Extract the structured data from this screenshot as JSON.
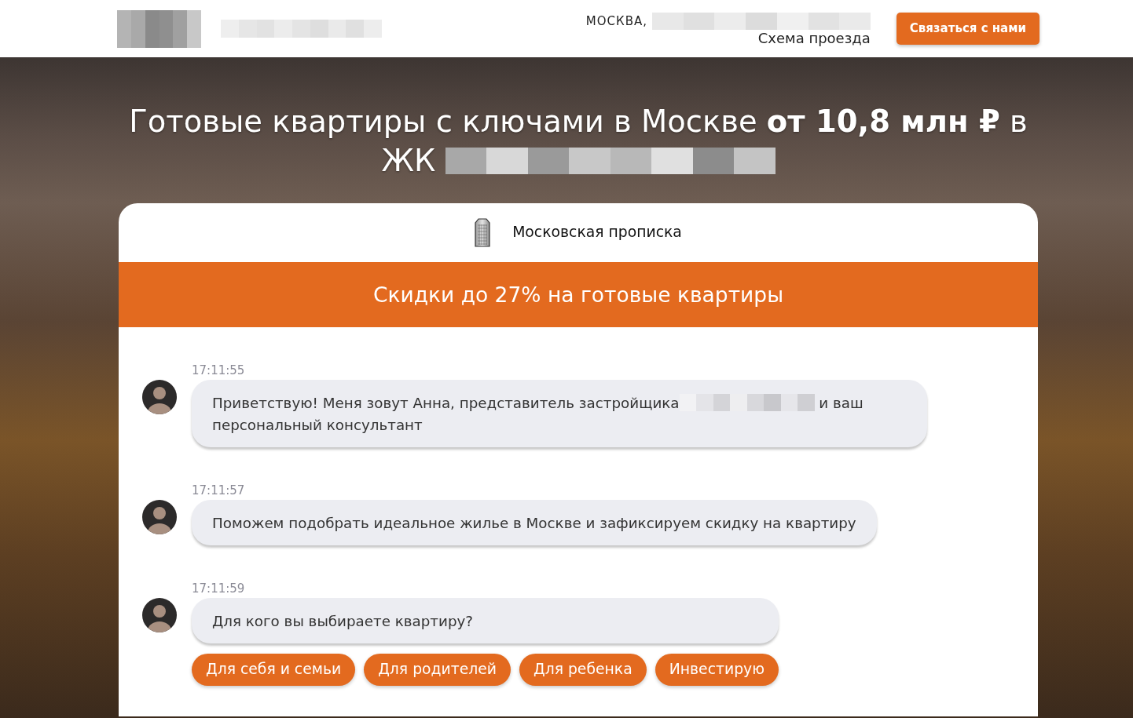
{
  "header": {
    "address": {
      "city": "МОСКВА,",
      "address_blurred": true,
      "route_link": "Схема проезда"
    },
    "contact_button": "Связаться с нами"
  },
  "hero": {
    "title": "Готовые квартиры с ключами в Москве **от 10,8 млн ₽** в ЖК",
    "title_tail_blurred": true
  },
  "card": {
    "feature": {
      "label": "Московская прописка"
    },
    "banner": "Скидки до 27% на готовые квартиры",
    "chat": [
      {
        "time": "17:11:55",
        "text": "Приветствую! Меня зовут Анна, представитель застройщика",
        "blurred_name": true,
        "text_after": "и ваш персональный консультант"
      },
      {
        "time": "17:11:57",
        "text": "Поможем подобрать идеальное жилье в Москве и зафиксируем скидку на квартиру",
        "blurred_name": false
      },
      {
        "time": "17:11:59",
        "text": "Для кого вы выбираете квартиру?",
        "blurred_name": false,
        "options": [
          "Для себя и семьи",
          "Для родителей",
          "Для ребенка",
          "Инвестирую"
        ]
      }
    ]
  }
}
